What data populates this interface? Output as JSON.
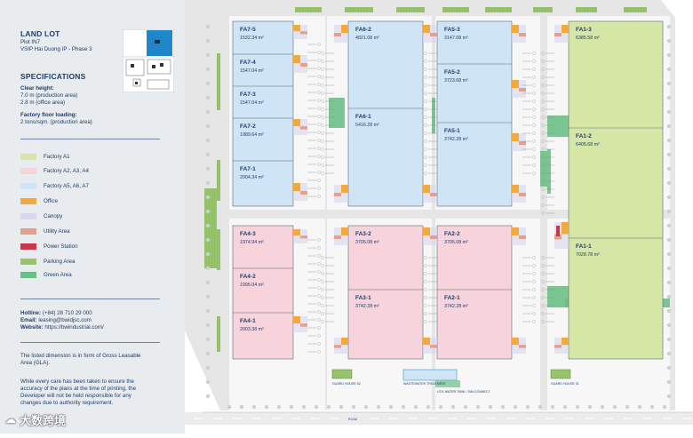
{
  "sidebar": {
    "title": "LAND LOT",
    "plot": "Plot IN7",
    "location": "VSIP Hai Duong IP - Phase 3",
    "specs_title": "SPECIFICATIONS",
    "clear_height_label": "Clear height:",
    "clear_height_1": "7.0 m (production area)",
    "clear_height_2": "2.8 m (office area)",
    "floor_loading_label": "Factory floor loading:",
    "floor_loading_value": "2 tons/sqm. (production area)",
    "legend": [
      {
        "label": "Factory A1",
        "color": "#d5e6a5"
      },
      {
        "label": "Factory A2, A3, A4",
        "color": "#f7d3dc"
      },
      {
        "label": "Factory A5, A6, A7",
        "color": "#cfe5f6"
      },
      {
        "label": "Office",
        "color": "#f4a93d"
      },
      {
        "label": "Canopy",
        "color": "#d6d6ef"
      },
      {
        "label": "Utility Area",
        "color": "#e3a08d"
      },
      {
        "label": "Power Station",
        "color": "#c8364a"
      },
      {
        "label": "Parking Area",
        "color": "#97c46b"
      },
      {
        "label": "Green Area",
        "color": "#6cbf86"
      }
    ],
    "contact": {
      "hotline_label": "Hotline:",
      "hotline": "(+84) 28 710 29 000",
      "email_label": "Email:",
      "email": "leasing@bwidjsc.com",
      "website_label": "Website:",
      "website": "https://bwindustrial.com/"
    },
    "note1_line1": "The listed dimension is in form of Gross Leasable",
    "note1_line2": "Area (GLA).",
    "note2_line1": "While every care has been taken to ensure the",
    "note2_line2": "accuracy of the plans at the time of printing, the",
    "note2_line3": "Developer will not be held responsible for any",
    "note2_line4": "changes due to authority requirement."
  },
  "watermark": "大数跨境",
  "plan": {
    "units": [
      {
        "name": "FA7-5",
        "area": "1532.34 m²"
      },
      {
        "name": "FA7-4",
        "area": "1547.04 m²"
      },
      {
        "name": "FA7-3",
        "area": "1547.04 m²"
      },
      {
        "name": "FA7-2",
        "area": "1989.64 m²"
      },
      {
        "name": "FA7-1",
        "area": "2004.34 m²"
      },
      {
        "name": "FA6-2",
        "area": "4821.08 m²"
      },
      {
        "name": "FA6-1",
        "area": "5416.28 m²"
      },
      {
        "name": "FA5-3",
        "area": "3147.08 m²"
      },
      {
        "name": "FA5-2",
        "area": "3723.68 m²"
      },
      {
        "name": "FA5-1",
        "area": "3742.28 m²"
      },
      {
        "name": "FA1-3",
        "area": "6385.58 m²"
      },
      {
        "name": "FA1-2",
        "area": "6405.68 m²"
      },
      {
        "name": "FA1-1",
        "area": "7028.78 m²"
      },
      {
        "name": "FA4-3",
        "area": "1974.94 m²"
      },
      {
        "name": "FA4-2",
        "area": "1995.04 m²"
      },
      {
        "name": "FA4-1",
        "area": "2003.38 m²"
      },
      {
        "name": "FA3-2",
        "area": "3705.08 m²"
      },
      {
        "name": "FA3-1",
        "area": "3742.28 m²"
      },
      {
        "name": "FA2-2",
        "area": "3705.08 m²"
      },
      {
        "name": "FA2-1",
        "area": "3742.28 m²"
      }
    ],
    "guard_house_left": "GUARD HOUSE 02",
    "guard_house_right": "GUARD HOUSE 01",
    "wastewater": "WASTEWATER TREATMENT",
    "water_tank": "UTIL WATER TANK / SIM CONNECT",
    "road": "ROAD"
  }
}
